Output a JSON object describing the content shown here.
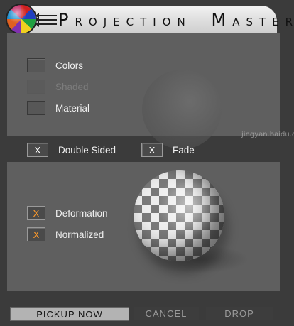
{
  "app": {
    "title_parts": [
      {
        "cap": "P",
        "rest": "ROJECTION"
      },
      {
        "cap": "M",
        "rest": "ASTER"
      }
    ]
  },
  "top_panel": {
    "options": [
      {
        "label": "Colors",
        "state": "unchecked"
      },
      {
        "label": "Shaded",
        "state": "disabled"
      },
      {
        "label": "Material",
        "state": "unchecked"
      }
    ]
  },
  "middle_row": {
    "double_sided": {
      "label": "Double Sided",
      "mark": "X"
    },
    "fade": {
      "label": "Fade",
      "mark": "X"
    }
  },
  "bottom_panel": {
    "deformation": {
      "label": "Deformation",
      "mark": "X"
    },
    "normalized": {
      "label": "Normalized",
      "mark": "X"
    }
  },
  "buttons": {
    "pickup": "PICKUP NOW",
    "cancel": "CANCEL",
    "drop": "DROP"
  },
  "watermark": "jingyan.baidu.com",
  "colors": {
    "accent_check": "#ff9a2a",
    "panel": "#5f5f5f",
    "background": "#3b3b3b"
  }
}
